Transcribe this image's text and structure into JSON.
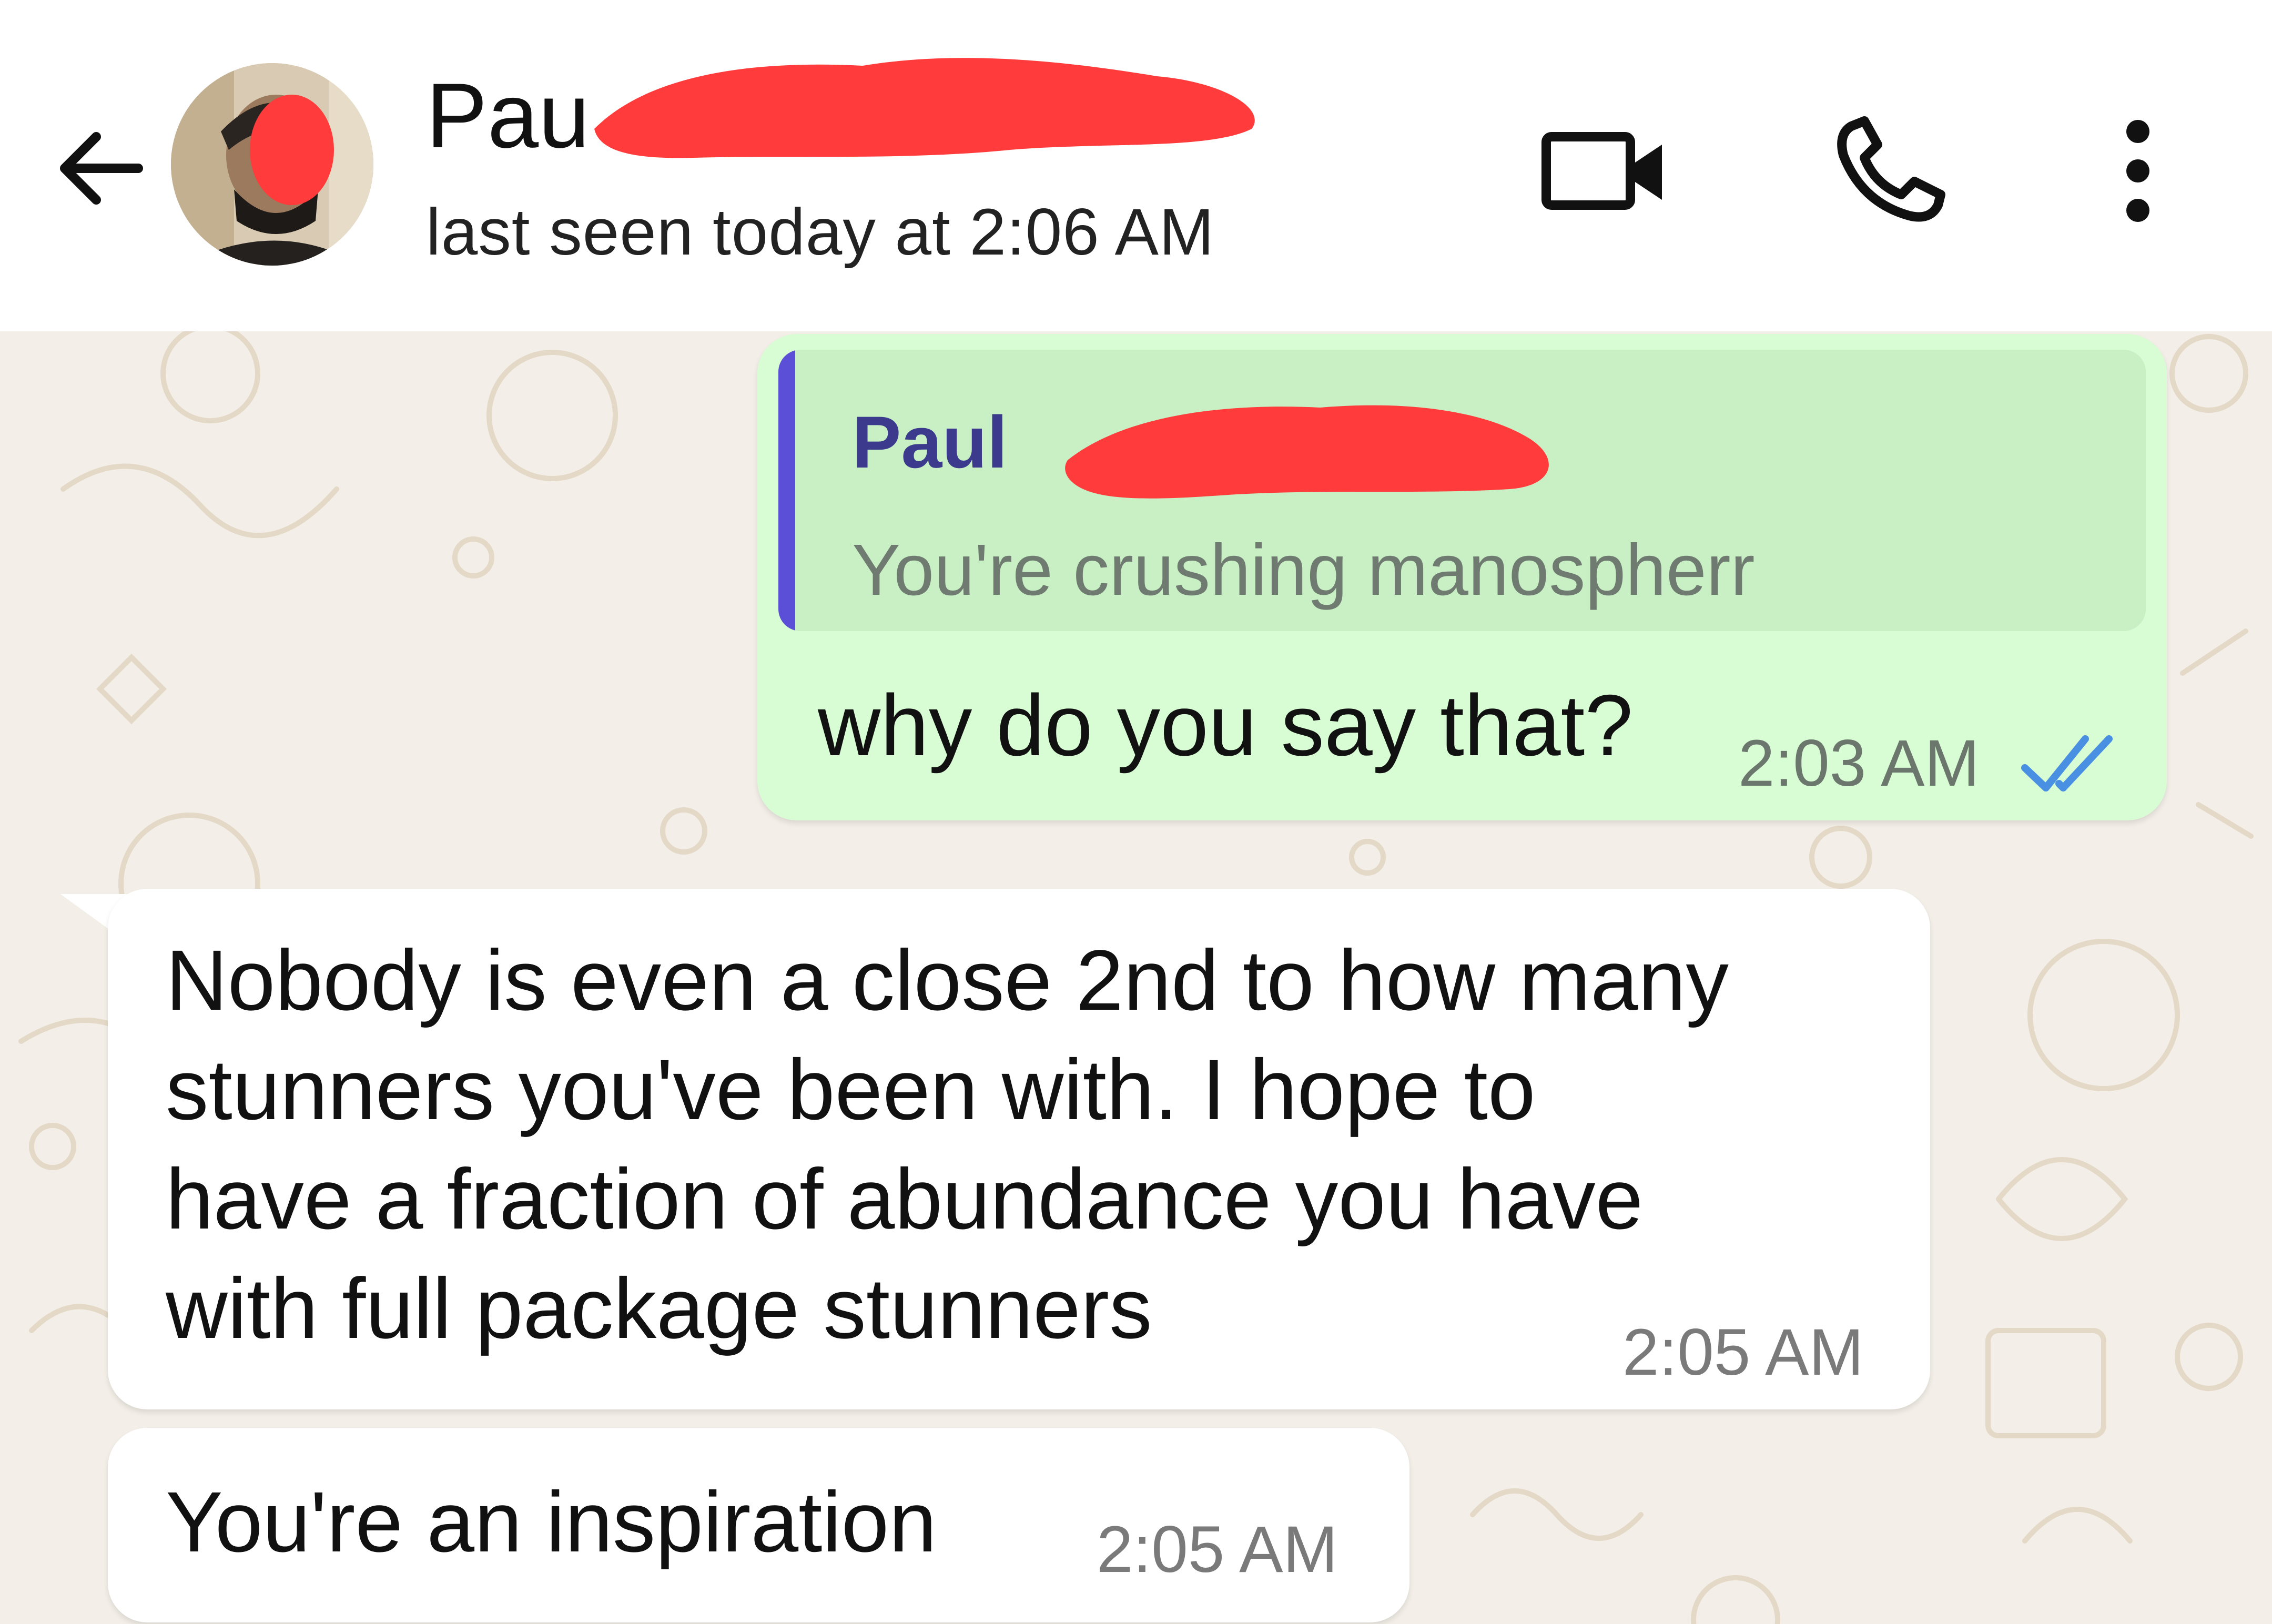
{
  "header": {
    "contact_name": "Pau",
    "last_seen": "last seen today at 2:06 AM"
  },
  "messages": {
    "outgoing": {
      "quoted_author": "Paul",
      "quoted_text": "You're crushing manospherr",
      "text": "why do you say that?",
      "time": "2:03 AM",
      "status": "read"
    },
    "incoming_1": {
      "lines": [
        "Nobody is even a close 2nd to how many",
        "stunners you've been with. I hope to",
        "have a fraction of abundance you have",
        "with full package stunners"
      ],
      "time": "2:05 AM"
    },
    "incoming_2": {
      "text": "You're an inspiration",
      "time": "2:05 AM"
    }
  },
  "colors": {
    "header_bg": "#ffffff",
    "chat_bg": "#f3efe8",
    "outgoing_bubble": "#d8fcd4",
    "quote_bg": "#c8f0c4",
    "quote_bar": "#5b4fd8",
    "read_ticks": "#4a90e2",
    "redaction": "#ff3b3b"
  },
  "icons": [
    "back-arrow-icon",
    "video-call-icon",
    "phone-call-icon",
    "more-options-icon",
    "read-receipt-icon"
  ]
}
